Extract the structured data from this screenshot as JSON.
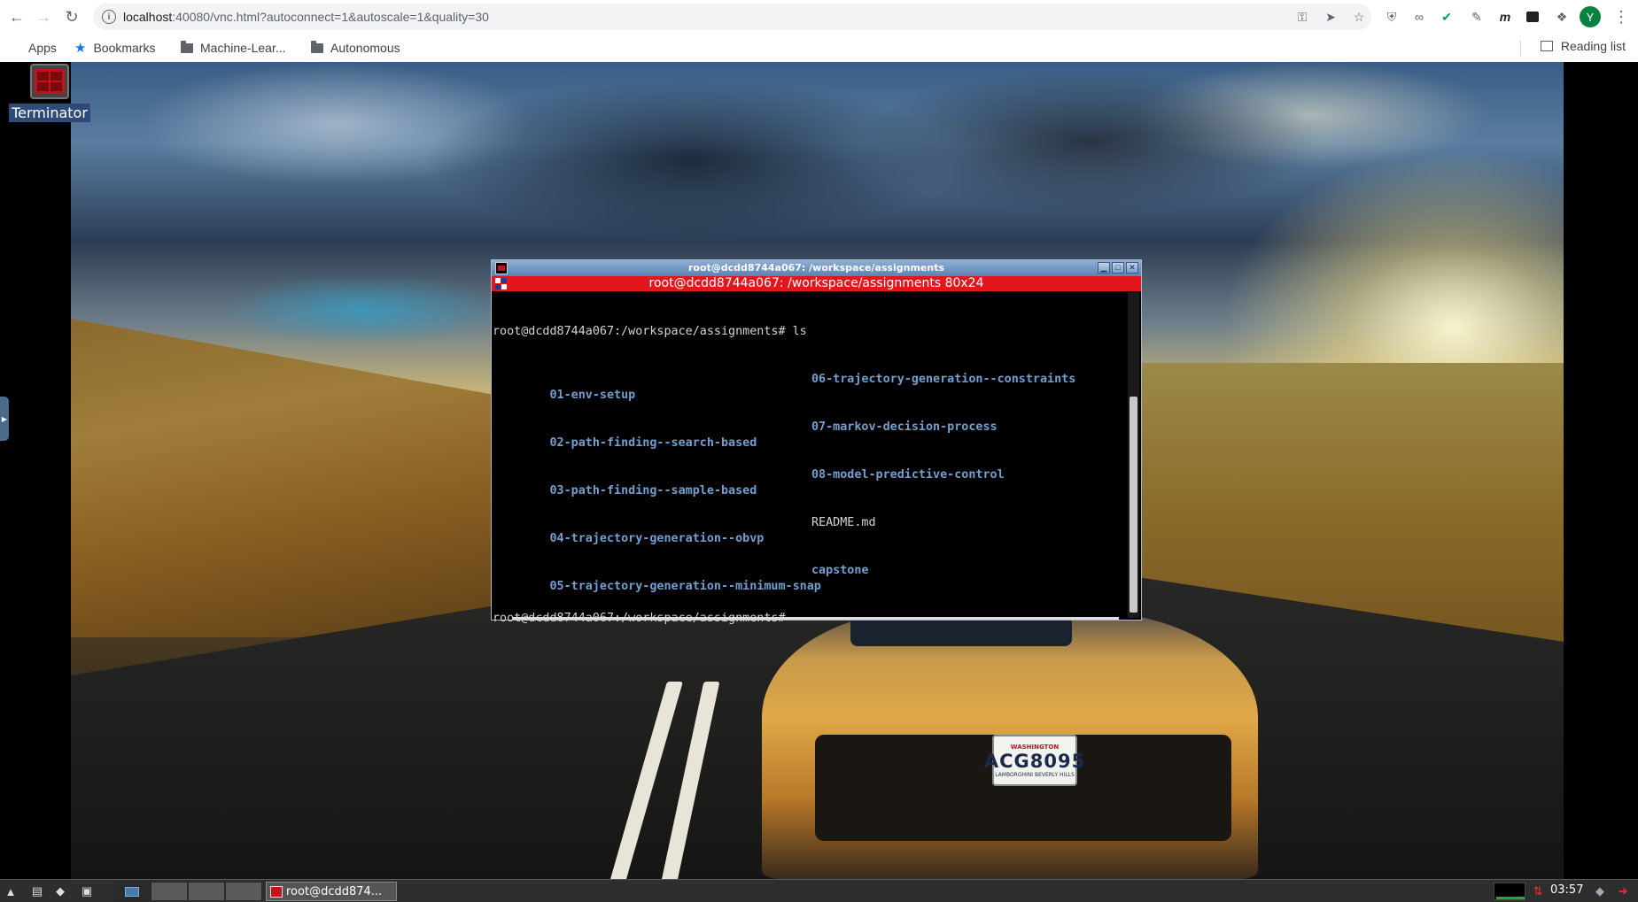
{
  "browser": {
    "url_host": "localhost",
    "url_rest": ":40080/vnc.html?autoconnect=1&autoscale=1&quality=30",
    "profile_initial": "Y",
    "bookmarks": [
      {
        "label": "Apps",
        "icon": "apps-grid-icon"
      },
      {
        "label": "Bookmarks",
        "icon": "star-icon"
      },
      {
        "label": "Machine-Lear...",
        "icon": "folder-icon"
      },
      {
        "label": "Autonomous",
        "icon": "folder-icon"
      }
    ],
    "reading_list": "Reading list"
  },
  "desktop": {
    "icon_label": "Terminator",
    "plate": {
      "state": "WASHINGTON",
      "number": "ACG8095",
      "dealer": "LAMBORGHINI BEVERLY HILLS"
    }
  },
  "terminal": {
    "window_title": "root@dcdd8744a067: /workspace/assignments",
    "header": "root@dcdd8744a067: /workspace/assignments 80x24",
    "prompt_command": "root@dcdd8744a067:/workspace/assignments# ls",
    "listing": [
      {
        "left": "01-env-setup",
        "left_type": "dir",
        "right": "06-trajectory-generation--constraints",
        "right_type": "dir"
      },
      {
        "left": "02-path-finding--search-based",
        "left_type": "dir",
        "right": "07-markov-decision-process",
        "right_type": "dir"
      },
      {
        "left": "03-path-finding--sample-based",
        "left_type": "dir",
        "right": "08-model-predictive-control",
        "right_type": "dir"
      },
      {
        "left": "04-trajectory-generation--obvp",
        "left_type": "dir",
        "right": "README.md",
        "right_type": "file"
      },
      {
        "left": "05-trajectory-generation--minimum-snap",
        "left_type": "dir",
        "right": "capstone",
        "right_type": "dir"
      }
    ],
    "prompt_final": "root@dcdd8744a067:/workspace/assignments#"
  },
  "taskbar": {
    "task_label": "root@dcdd874...",
    "clock": "03:57"
  },
  "colors": {
    "terminal_header_red": "#e3161e",
    "dir_blue": "#729fcf"
  }
}
